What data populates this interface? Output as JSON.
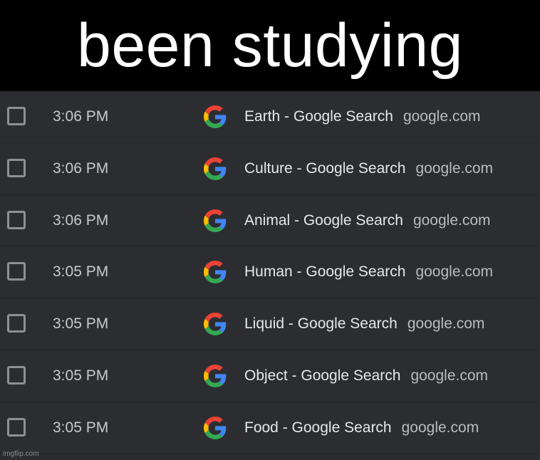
{
  "caption": "been studying",
  "history": [
    {
      "time": "3:06 PM",
      "title": "Earth - Google Search",
      "domain": "google.com",
      "icon": "google-icon"
    },
    {
      "time": "3:06 PM",
      "title": "Culture - Google Search",
      "domain": "google.com",
      "icon": "google-icon"
    },
    {
      "time": "3:06 PM",
      "title": "Animal - Google Search",
      "domain": "google.com",
      "icon": "google-icon"
    },
    {
      "time": "3:05 PM",
      "title": "Human - Google Search",
      "domain": "google.com",
      "icon": "google-icon"
    },
    {
      "time": "3:05 PM",
      "title": "Liquid - Google Search",
      "domain": "google.com",
      "icon": "google-icon"
    },
    {
      "time": "3:05 PM",
      "title": "Object - Google Search",
      "domain": "google.com",
      "icon": "google-icon"
    },
    {
      "time": "3:05 PM",
      "title": "Food - Google Search",
      "domain": "google.com",
      "icon": "google-icon"
    }
  ],
  "watermark": "imgflip.com",
  "colors": {
    "caption_bg": "#000000",
    "caption_text": "#ffffff",
    "list_bg": "#2c2d31",
    "google_blue": "#4285F4",
    "google_red": "#EA4335",
    "google_yellow": "#FBBC05",
    "google_green": "#34A853"
  }
}
